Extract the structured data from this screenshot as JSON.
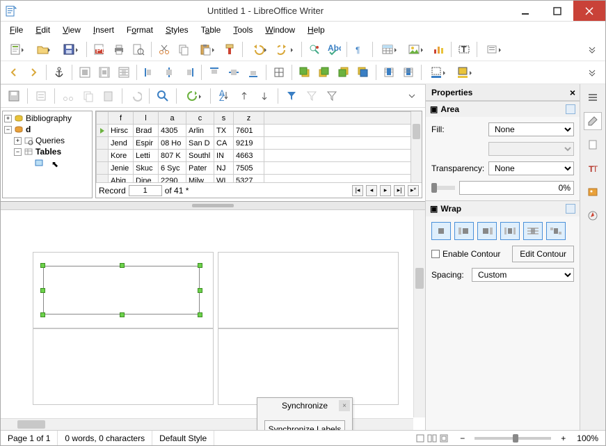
{
  "window": {
    "title": "Untitled 1 - LibreOffice Writer"
  },
  "menu": {
    "file": "File",
    "edit": "Edit",
    "view": "View",
    "insert": "Insert",
    "format": "Format",
    "styles": "Styles",
    "table": "Table",
    "tools": "Tools",
    "window": "Window",
    "help": "Help"
  },
  "tree": {
    "root1": "Bibliography",
    "root2": "d",
    "queries": "Queries",
    "tables": "Tables"
  },
  "grid": {
    "headers": [
      "f",
      "l",
      "a",
      "c",
      "s",
      "z"
    ],
    "rows": [
      [
        "Hirsc",
        "Brad",
        "4305",
        "Arlin",
        "TX",
        "7601"
      ],
      [
        "Jend",
        "Espir",
        "08 Ho",
        "San D",
        "CA",
        "9219"
      ],
      [
        "Kore",
        "Letti",
        "807 K",
        "Southl",
        "IN",
        "4663"
      ],
      [
        "Jenie",
        "Skuc",
        "6 Syc",
        "Pater",
        "NJ",
        "7505"
      ],
      [
        "Abig",
        "Dine",
        "2290",
        "Milw",
        "WI",
        "5327"
      ]
    ],
    "record_label": "Record",
    "record_value": "1",
    "record_of": "of 41 *"
  },
  "sync": {
    "title": "Synchronize",
    "button": "Synchronize Labels"
  },
  "sidebar": {
    "title": "Properties",
    "area": {
      "title": "Area",
      "fill_label": "Fill:",
      "fill_value": "None",
      "trans_label": "Transparency:",
      "trans_value": "None",
      "trans_pct": "0%"
    },
    "wrap": {
      "title": "Wrap",
      "enable_contour": "Enable Contour",
      "edit_contour": "Edit Contour",
      "spacing_label": "Spacing:",
      "spacing_value": "Custom"
    }
  },
  "status": {
    "page": "Page 1 of 1",
    "words": "0 words, 0 characters",
    "style": "Default Style",
    "zoom": "100%"
  }
}
